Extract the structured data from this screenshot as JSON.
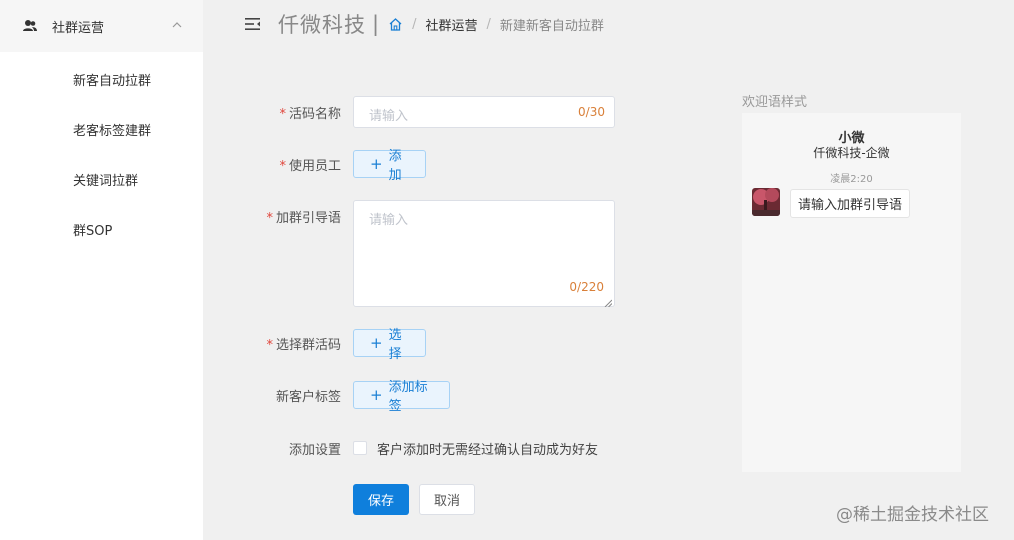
{
  "sidebar": {
    "group_label": "社群运营",
    "items": [
      {
        "label": "新客自动拉群"
      },
      {
        "label": "老客标签建群"
      },
      {
        "label": "关键词拉群"
      },
      {
        "label": "群SOP"
      }
    ]
  },
  "header": {
    "brand": "仟微科技",
    "brand_sep": "|",
    "breadcrumb": [
      "社群运营",
      "新建新客自动拉群"
    ],
    "crumb_sep": "/"
  },
  "form": {
    "code_name": {
      "required": "*",
      "label": "活码名称",
      "placeholder": "请输入",
      "counter": "0/30"
    },
    "staff": {
      "required": "*",
      "label": "使用员工",
      "button": "添加"
    },
    "guide": {
      "required": "*",
      "label": "加群引导语",
      "placeholder": "请输入",
      "counter": "0/220"
    },
    "group_code": {
      "required": "*",
      "label": "选择群活码",
      "button": "选择"
    },
    "tags": {
      "label": "新客户标签",
      "button": "添加标签"
    },
    "settings": {
      "label": "添加设置",
      "checkbox_text": "客户添加时无需经过确认自动成为好友",
      "checked": false
    },
    "save_label": "保存",
    "cancel_label": "取消",
    "plus_glyph": "+"
  },
  "preview": {
    "title": "欢迎语样式",
    "name": "小微",
    "corp": "仟微科技-企微",
    "time": "凌晨2:20",
    "message": "请输入加群引导语"
  },
  "watermark": "@稀土掘金技术社区",
  "colors": {
    "primary": "#0f7fdc",
    "required": "#e0443a",
    "counter": "#d9803a"
  }
}
